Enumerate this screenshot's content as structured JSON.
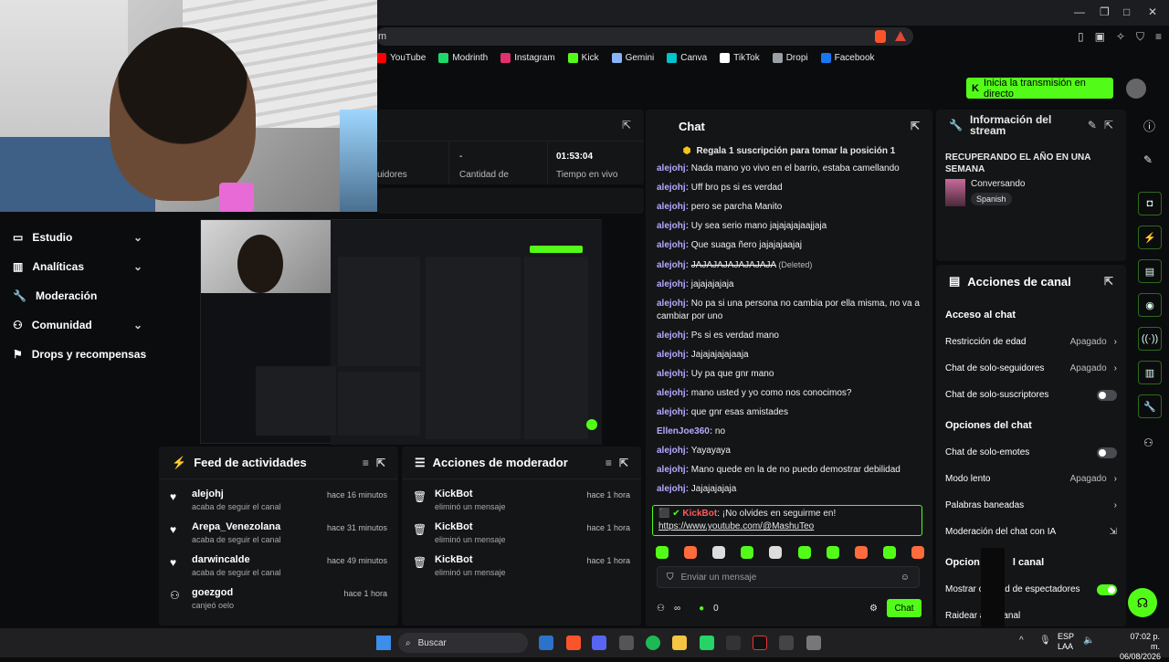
{
  "browser": {
    "url_fragment": "m",
    "bookmarks": [
      {
        "label": "YouTube",
        "color": "#ff0000"
      },
      {
        "label": "Modrinth",
        "color": "#1bd96a"
      },
      {
        "label": "Instagram",
        "color": "#e1306c"
      },
      {
        "label": "Kick",
        "color": "#53fc18"
      },
      {
        "label": "Gemini",
        "color": "#8ab4f8"
      },
      {
        "label": "Canva",
        "color": "#00c4cc"
      },
      {
        "label": "TikTok",
        "color": "#ffffff"
      },
      {
        "label": "Dropi",
        "color": "#9aa0a6"
      },
      {
        "label": "Facebook",
        "color": "#1877f2"
      }
    ]
  },
  "header": {
    "go_live": "Inicia la transmisión en directo"
  },
  "stats": {
    "followers_label": "uidores",
    "dash": "-",
    "quantity_label": "Cantidad de",
    "time": "01:53:04",
    "time_label": "Tiempo en vivo"
  },
  "sidebar": {
    "items": [
      {
        "label": "Estudio",
        "expand": true
      },
      {
        "label": "Analíticas",
        "expand": true
      },
      {
        "label": "Moderación",
        "expand": false
      },
      {
        "label": "Comunidad",
        "expand": true
      },
      {
        "label": "Drops y recompensas",
        "expand": false
      }
    ]
  },
  "feed": {
    "title": "Feed de actividades",
    "items": [
      {
        "name": "alejohj",
        "sub": "acaba de seguir el canal",
        "time": "hace 16 minutos"
      },
      {
        "name": "Arepa_Venezolana",
        "sub": "acaba de seguir el canal",
        "time": "hace 31 minutos"
      },
      {
        "name": "darwincalde",
        "sub": "acaba de seguir el canal",
        "time": "hace 49 minutos"
      },
      {
        "name": "goezgod",
        "sub": "canjeó oelo",
        "time": "hace 1 hora"
      }
    ]
  },
  "mod_actions": {
    "title": "Acciones de moderador",
    "items": [
      {
        "name": "KickBot",
        "sub": "eliminó un mensaje",
        "time": "hace 1 hora"
      },
      {
        "name": "KickBot",
        "sub": "eliminó un mensaje",
        "time": "hace 1 hora"
      },
      {
        "name": "KickBot",
        "sub": "eliminó un mensaje",
        "time": "hace 1 hora"
      }
    ]
  },
  "chat": {
    "title": "Chat",
    "pinned": "Regala 1 suscripción para tomar la posición 1",
    "messages": [
      {
        "user": "alejohj",
        "text": "Nada mano yo vivo en el barrio, estaba camellando"
      },
      {
        "user": "alejohj",
        "text": "Uff bro ps si es verdad"
      },
      {
        "user": "alejohj",
        "text": "pero se parcha Manito"
      },
      {
        "user": "alejohj",
        "text": "Uy sea serio mano jajajajajaajjaja"
      },
      {
        "user": "alejohj",
        "text": "Que suaga ñero jajajajaajaj"
      },
      {
        "user": "alejohj",
        "text": "JAJAJAJAJAJAJAJA",
        "deleted": "(Deleted)"
      },
      {
        "user": "alejohj",
        "text": "jajajajajaja"
      },
      {
        "user": "alejohj",
        "text": "No pa si una persona no cambia por ella misma, no va a cambiar por uno"
      },
      {
        "user": "alejohj",
        "text": "Ps si es verdad mano"
      },
      {
        "user": "alejohj",
        "text": "Jajajajajajaaja"
      },
      {
        "user": "alejohj",
        "text": "Uy pa que gnr mano"
      },
      {
        "user": "alejohj",
        "text": "mano usted y yo como nos conocimos?"
      },
      {
        "user": "alejohj",
        "text": "que gnr esas amistades"
      },
      {
        "user": "EllenJoe360",
        "text": "no"
      },
      {
        "user": "alejohj",
        "text": "Yayayaya"
      },
      {
        "user": "alejohj",
        "text": "Mano quede en la de no puedo demostrar debilidad"
      },
      {
        "user": "alejohj",
        "text": "Jajajajajaja"
      }
    ],
    "bot": {
      "user": "KickBot",
      "text": "¡No olvides en seguirme en!",
      "link": "https://www.youtube.com/@MashuTeo"
    },
    "input_placeholder": "Enviar un mensaje",
    "points": "0",
    "send": "Chat"
  },
  "info": {
    "title": "Información del stream",
    "stream_title": "RECUPERANDO EL AÑO EN UNA SEMANA",
    "category": "Conversando",
    "language": "Spanish"
  },
  "actions": {
    "title": "Acciones de canal",
    "chat_access": "Acceso al chat",
    "age": {
      "label": "Restricción de edad",
      "value": "Apagado"
    },
    "followers": {
      "label": "Chat de solo-seguidores",
      "value": "Apagado"
    },
    "subs": {
      "label": "Chat de solo-suscriptores"
    },
    "chat_options": "Opciones del chat",
    "emotes": {
      "label": "Chat de solo-emotes"
    },
    "slow": {
      "label": "Modo lento",
      "value": "Apagado"
    },
    "banned": {
      "label": "Palabras baneadas"
    },
    "ai": {
      "label": "Moderación del chat con IA"
    },
    "channel_options_a": "Opcion",
    "channel_options_b": "l canal",
    "viewers_a": "Mostrar c",
    "viewers_b": "ad de espectadores",
    "raid_a": "Raidear a",
    "raid_b": "anal"
  },
  "taskbar": {
    "search": "Buscar",
    "lang1": "ESP",
    "lang2": "LAA",
    "time": "07:02 p. m.",
    "date": "06/08/2026"
  }
}
